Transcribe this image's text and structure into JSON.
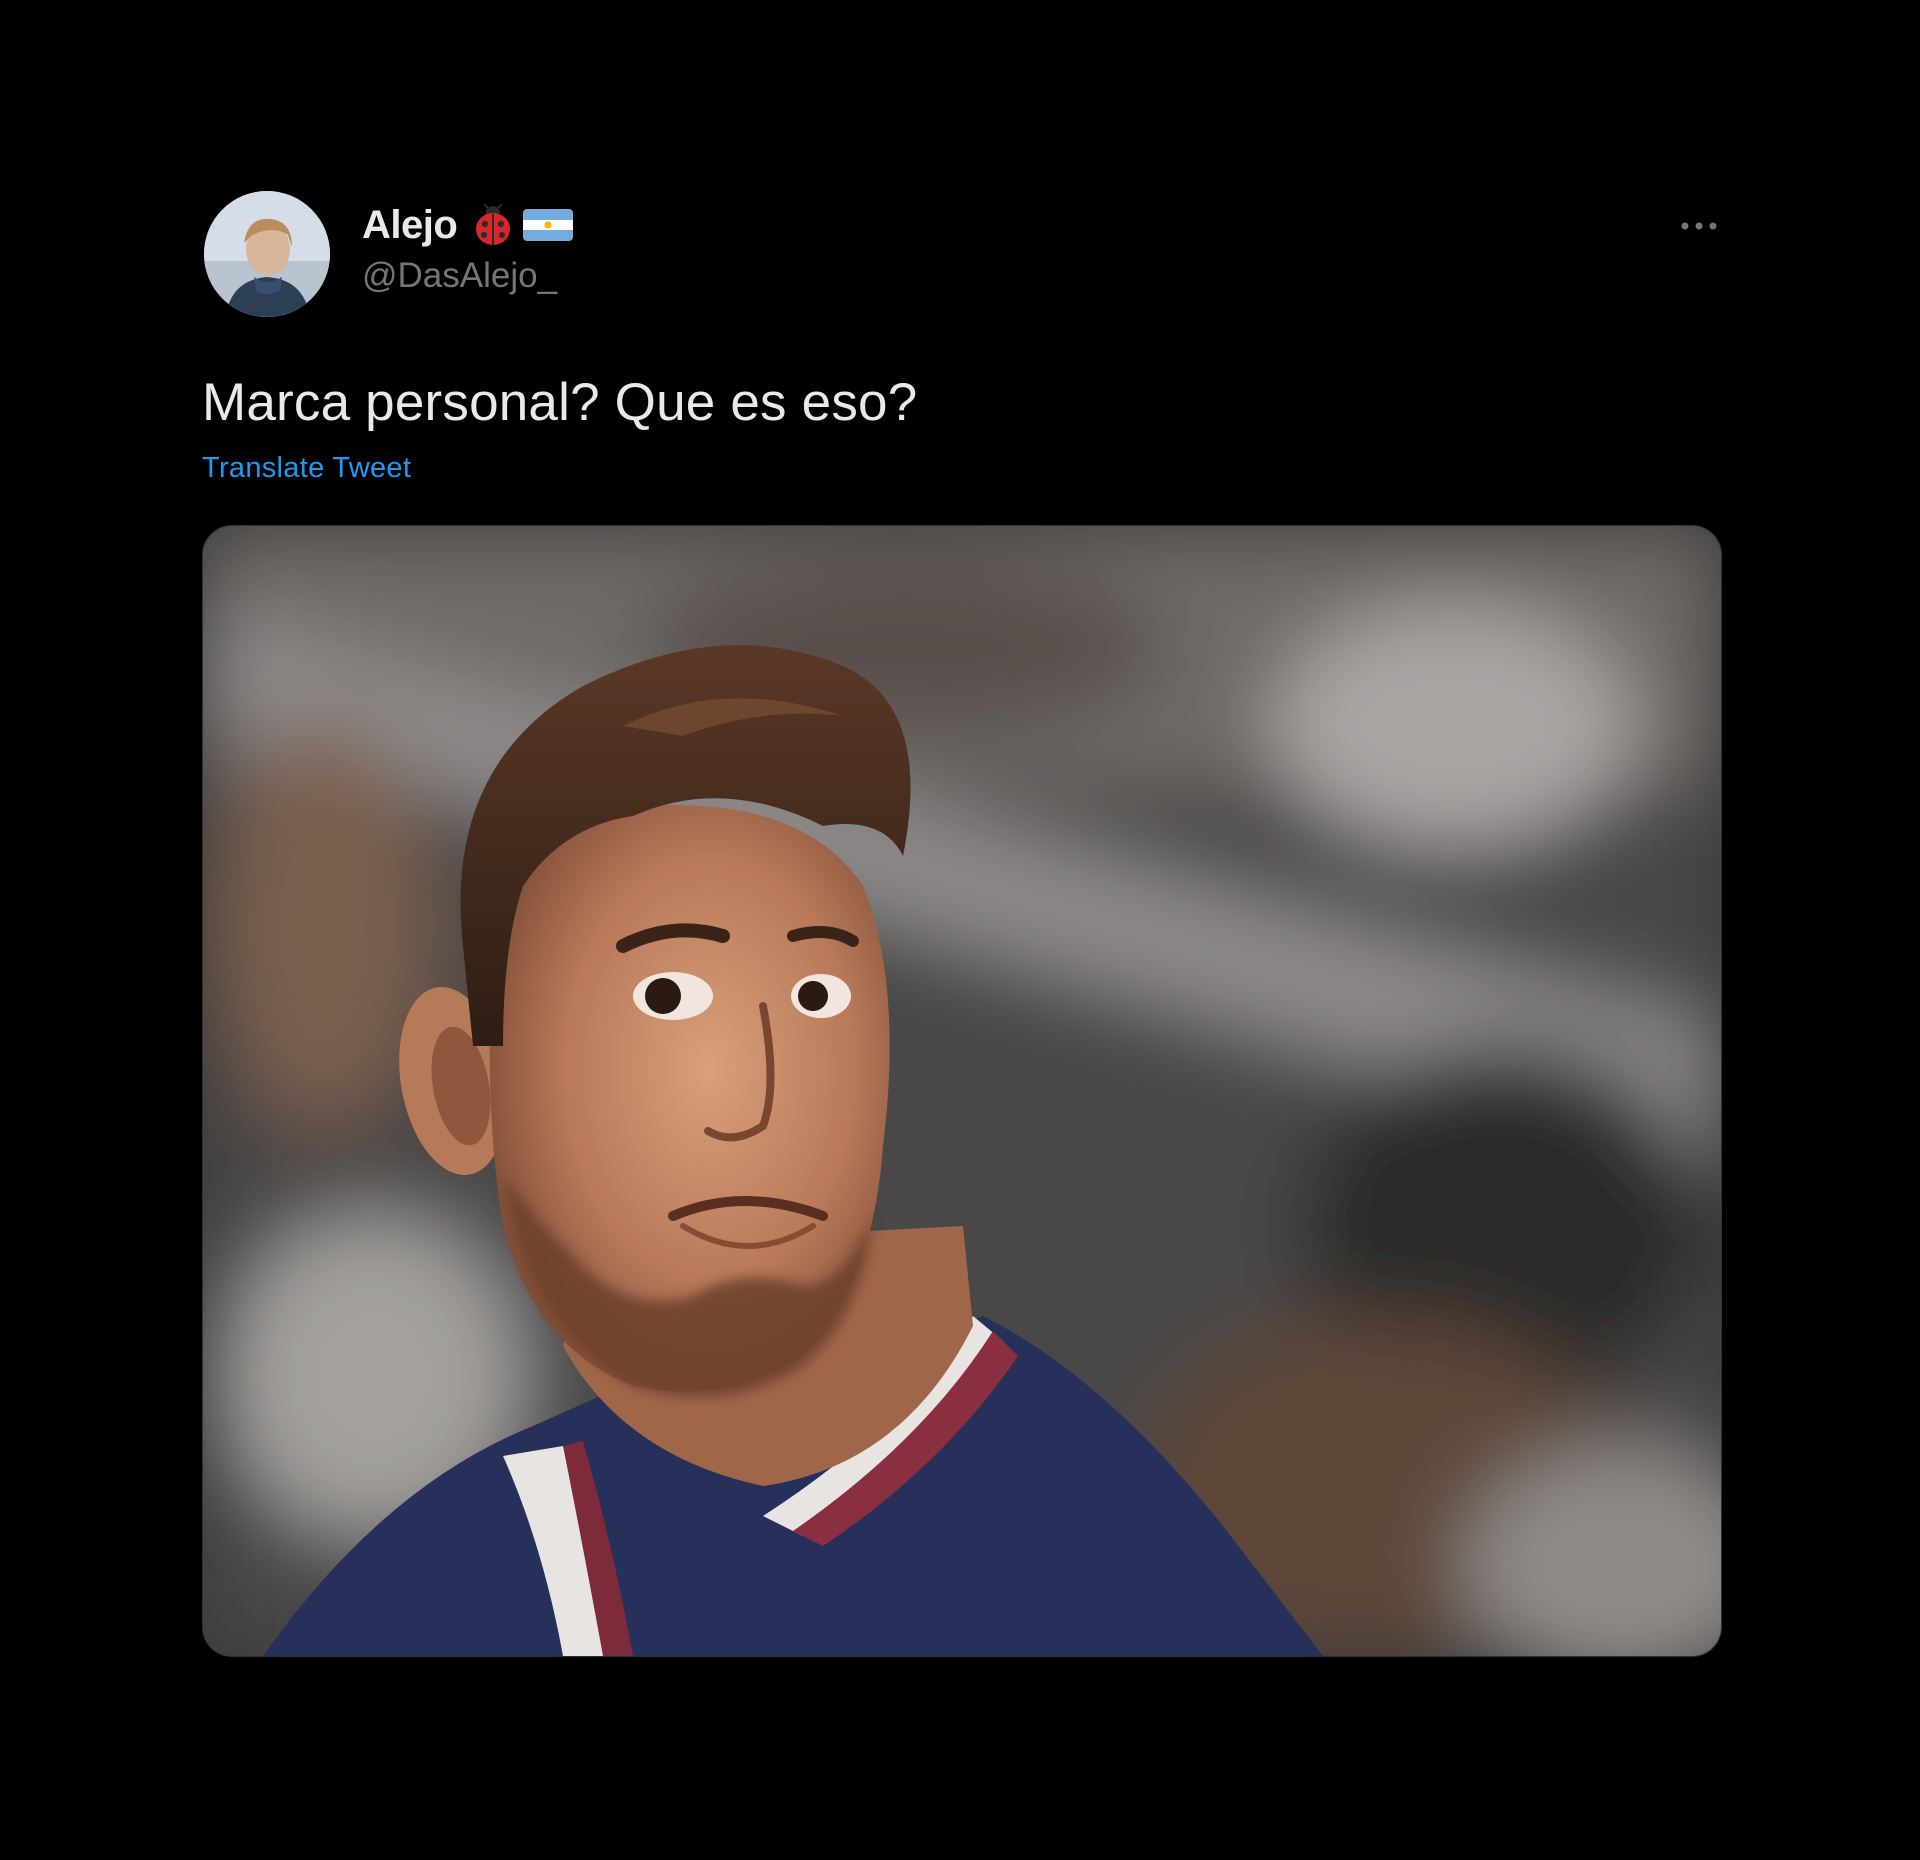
{
  "tweet": {
    "author": {
      "display_name": "Alejo",
      "handle": "@DasAlejo_",
      "badges": [
        "ladybug-emoji-icon",
        "argentina-flag-icon"
      ]
    },
    "text": "Marca personal? Que es eso?",
    "translate_label": "Translate Tweet",
    "more_icon": "more-options-icon",
    "media": {
      "description": "photo"
    }
  },
  "colors": {
    "background": "#000000",
    "text_primary": "#e7e9ea",
    "text_secondary": "#71767b",
    "link": "#1d9bf0"
  }
}
